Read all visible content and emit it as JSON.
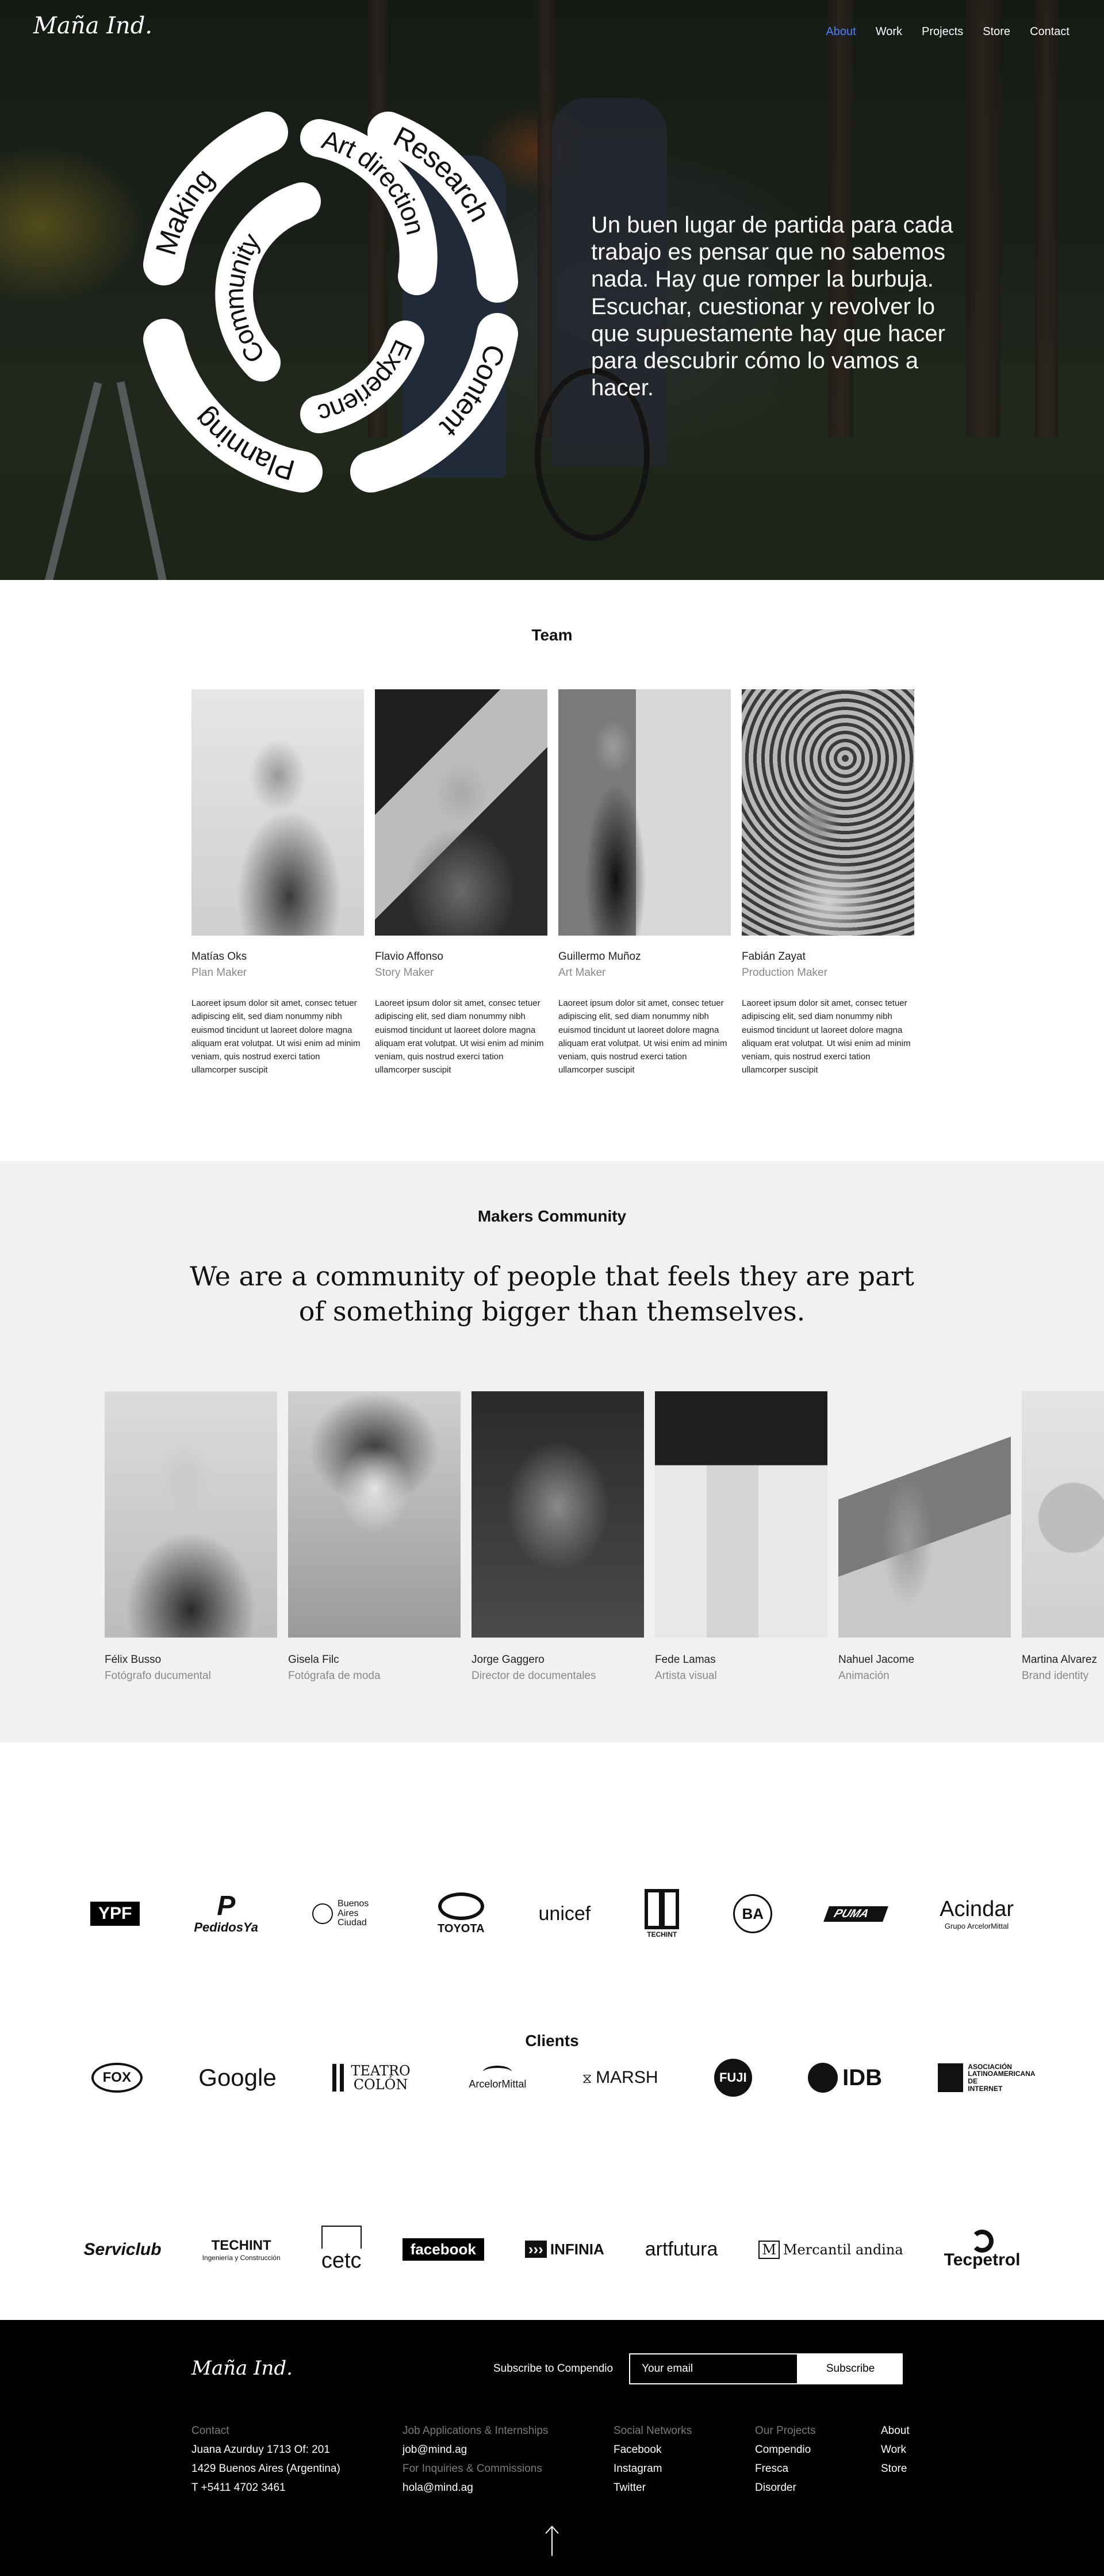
{
  "nav": {
    "logo": "Maña Ind.",
    "items": [
      "About",
      "Work",
      "Projects",
      "Store",
      "Contact"
    ],
    "active_index": 0
  },
  "hero": {
    "circle_words": [
      "Making",
      "Art direction",
      "Research",
      "Community",
      "Experience",
      "Content",
      "Planning"
    ],
    "text": "Un buen lugar de partida para cada trabajo es pensar que no sabemos nada. Hay que romper la burbuja. Escuchar, cuestionar y revolver lo que supuestamente hay que hacer para descubrir cómo lo vamos a hacer."
  },
  "team": {
    "title": "Team",
    "members": [
      {
        "name": "Matías Oks",
        "role": "Plan Maker",
        "bio": "Laoreet ipsum dolor sit amet, consec tetuer adipiscing elit, sed diam nonummy nibh euismod tincidunt ut laoreet dolore magna aliquam erat volutpat. Ut wisi enim ad minim veniam, quis nostrud exerci tation ullamcorper suscipit"
      },
      {
        "name": "Flavio Affonso",
        "role": "Story Maker",
        "bio": "Laoreet ipsum dolor sit amet, consec tetuer adipiscing elit, sed diam nonummy nibh euismod tincidunt ut laoreet dolore magna aliquam erat volutpat. Ut wisi enim ad minim veniam, quis nostrud exerci tation ullamcorper suscipit"
      },
      {
        "name": "Guillermo Muñoz",
        "role": "Art Maker",
        "bio": "Laoreet ipsum dolor sit amet, consec tetuer adipiscing elit, sed diam nonummy nibh euismod tincidunt ut laoreet dolore magna aliquam erat volutpat. Ut wisi enim ad minim veniam, quis nostrud exerci tation ullamcorper suscipit"
      },
      {
        "name": "Fabián Zayat",
        "role": "Production Maker",
        "bio": "Laoreet ipsum dolor sit amet, consec tetuer adipiscing elit, sed diam nonummy nibh euismod tincidunt ut laoreet dolore magna aliquam erat volutpat. Ut wisi enim ad minim veniam, quis nostrud exerci tation ullamcorper suscipit"
      }
    ]
  },
  "community": {
    "title": "Makers Community",
    "quote_line1": "We are a community of people that feels they are part",
    "quote_line2": "of something bigger than themselves.",
    "makers": [
      {
        "name": "Félix Busso",
        "role": "Fotógrafo ducumental"
      },
      {
        "name": "Gisela Filc",
        "role": "Fotógrafa de moda"
      },
      {
        "name": "Jorge Gaggero",
        "role": "Director de documentales"
      },
      {
        "name": "Fede Lamas",
        "role": "Artista visual"
      },
      {
        "name": "Nahuel Jacome",
        "role": "Animación"
      },
      {
        "name": "Martina Alvarez",
        "role": "Brand identity"
      }
    ]
  },
  "clients": {
    "title": "Clients",
    "row1": [
      "YPF",
      "PedidosYa",
      "Buenos Aires Ciudad",
      "TOYOTA",
      "unicef",
      "TECHINT",
      "BA",
      "PUMA",
      "Acindar"
    ],
    "row1_sub": {
      "acindar": "Grupo ArcelorMittal"
    },
    "row2": [
      "FOX",
      "Google",
      "TEATRO COLÓN",
      "ArcelorMittal",
      "MARSH",
      "FUJI",
      "IDB",
      "ASOCIACIÓN LATINOAMERICANA DE INTERNET"
    ],
    "row3": [
      "Serviclub",
      "TECHINT",
      "cetc",
      "facebook",
      "INFINIA",
      "artfutura",
      "Mercantil andina",
      "Tecpetrol"
    ],
    "row3_sub": {
      "techint": "Ingeniería y Construcción"
    }
  },
  "footer": {
    "logo": "Maña Ind.",
    "subscribe_label": "Subscribe to Compendio",
    "email_placeholder": "Your email",
    "subscribe_button": "Subscribe",
    "contact": {
      "label": "Contact",
      "line1": "Juana Azurduy 1713 Of: 201",
      "line2": "1429 Buenos Aires (Argentina)",
      "line3": "T +5411 4702 3461"
    },
    "jobs": {
      "label": "Job Applications & Internships",
      "email": "job@mind.ag",
      "label2": "For Inquiries & Commissions",
      "email2": "hola@mind.ag"
    },
    "social": {
      "label": "Social Networks",
      "items": [
        "Facebook",
        "Instagram",
        "Twitter"
      ]
    },
    "projects": {
      "label": "Our Projects",
      "items": [
        "Compendio",
        "Fresca",
        "Disorder"
      ]
    },
    "links": [
      "About",
      "Work",
      "Store"
    ]
  }
}
